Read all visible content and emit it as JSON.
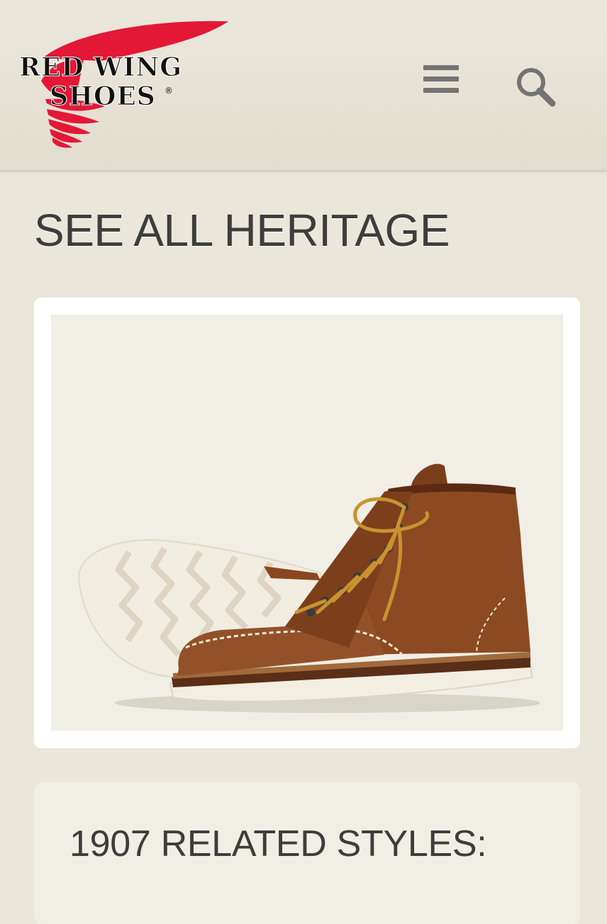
{
  "header": {
    "logo": {
      "line1": "RED WING",
      "line2": "SHOES",
      "registered": "®"
    },
    "menu_icon": "hamburger-menu-icon",
    "search_icon": "search-icon"
  },
  "page": {
    "title": "SEE ALL HERITAGE"
  },
  "product": {
    "image": "moc-toe-boot"
  },
  "related": {
    "title": "1907 RELATED STYLES:"
  },
  "colors": {
    "brand_red": "#e31837",
    "background": "#ebe6da",
    "text": "#3d3d3d",
    "leather": "#8b4a22"
  }
}
